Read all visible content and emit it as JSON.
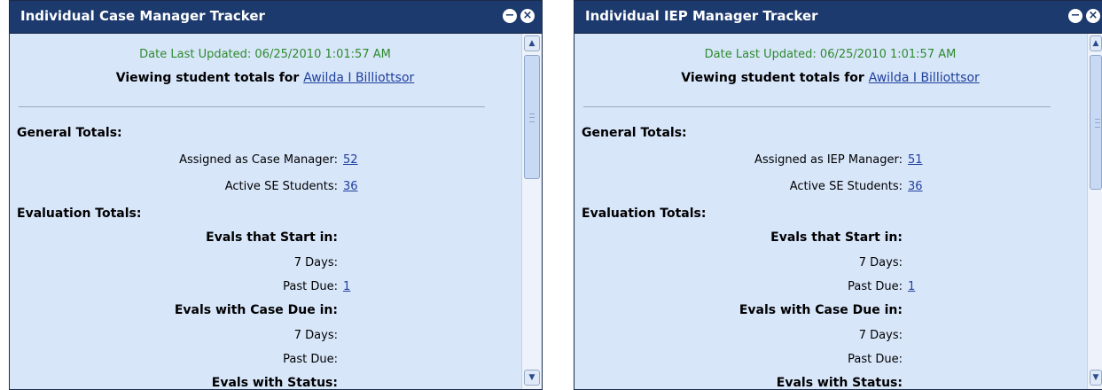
{
  "panels": [
    {
      "title": "Individual Case Manager Tracker",
      "date_updated": "Date Last Updated: 06/25/2010 1:01:57 AM",
      "viewing_label": "Viewing student totals for",
      "viewing_name": "Awilda I Billiottsor",
      "general_totals_label": "General Totals:",
      "assigned_label": "Assigned as Case Manager:",
      "assigned_value": "52",
      "active_label": "Active SE Students:",
      "active_value": "36",
      "evaluation_totals_label": "Evaluation Totals:",
      "evals_start_label": "Evals that Start in:",
      "start_7days_label": "7 Days:",
      "start_7days_value": "",
      "start_pastdue_label": "Past Due:",
      "start_pastdue_value": "1",
      "evals_case_due_label": "Evals with Case Due in:",
      "case_7days_label": "7 Days:",
      "case_7days_value": "",
      "case_pastdue_label": "Past Due:",
      "case_pastdue_value": "",
      "evals_status_label": "Evals with Status:"
    },
    {
      "title": "Individual IEP Manager Tracker",
      "date_updated": "Date Last Updated: 06/25/2010 1:01:57 AM",
      "viewing_label": "Viewing student totals for",
      "viewing_name": "Awilda I Billiottsor",
      "general_totals_label": "General Totals:",
      "assigned_label": "Assigned as IEP Manager:",
      "assigned_value": "51",
      "active_label": "Active SE Students:",
      "active_value": "36",
      "evaluation_totals_label": "Evaluation Totals:",
      "evals_start_label": "Evals that Start in:",
      "start_7days_label": "7 Days:",
      "start_7days_value": "",
      "start_pastdue_label": "Past Due:",
      "start_pastdue_value": "1",
      "evals_case_due_label": "Evals with Case Due in:",
      "case_7days_label": "7 Days:",
      "case_7days_value": "",
      "case_pastdue_label": "Past Due:",
      "case_pastdue_value": "",
      "evals_status_label": "Evals with Status:"
    }
  ],
  "icons": {
    "minimize": "minus-circle-icon",
    "close": "x-circle-icon",
    "scroll_up": "chevron-up-icon",
    "scroll_down": "chevron-down-icon"
  },
  "colors": {
    "titlebar": "#1d3a6e",
    "panel_background": "#d8e6fa",
    "date_text": "#2e8b2e",
    "link": "#1f3f9c"
  }
}
